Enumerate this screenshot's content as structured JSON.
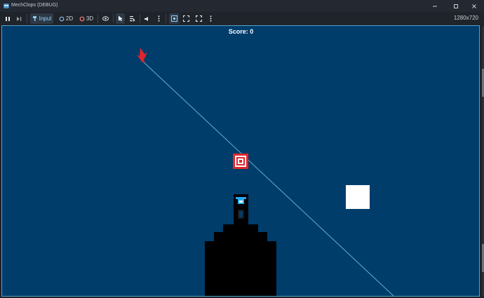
{
  "window": {
    "title": "MechClops (DEBUG)",
    "controls": [
      "minimize",
      "maximize",
      "close"
    ]
  },
  "toolbar": {
    "input_label": "Input",
    "mode_2d_label": "2D",
    "mode_3d_label": "3D",
    "resolution": "1280x720"
  },
  "game": {
    "score_text": "Score: 0"
  },
  "colors": {
    "background": "#003d6b",
    "aim_line": "#5fb0d8",
    "target_red": "#e0262b",
    "cursor_red": "#e0262b",
    "player_blue": "#2aa8f2"
  }
}
